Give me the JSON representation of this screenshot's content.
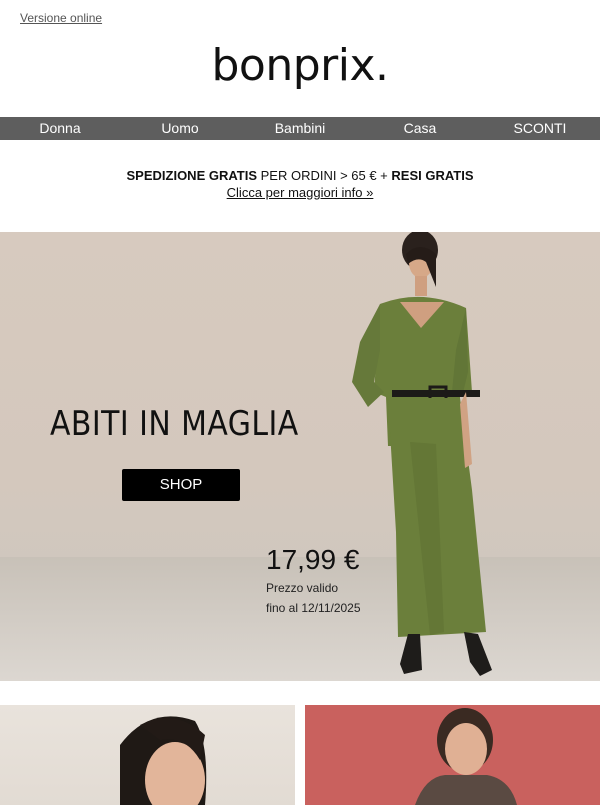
{
  "header": {
    "online_link": "Versione online",
    "logo": "bonprix."
  },
  "nav": {
    "items": [
      "Donna",
      "Uomo",
      "Bambini",
      "Casa",
      "SCONTI"
    ]
  },
  "shipping": {
    "part1_bold": "SPEDIZIONE GRATIS",
    "part2": " PER ORDINI > 65 € + ",
    "part3_bold": "RESI GRATIS",
    "link": "Clicca per maggiori info »"
  },
  "hero": {
    "title": "ABITI IN MAGLIA",
    "button": "SHOP",
    "price": "17,99 €",
    "validity_line1": "Prezzo valido",
    "validity_line2": "fino al 12/11/2025"
  },
  "colors": {
    "nav_bg": "#5e5e5e",
    "dress_green": "#6b7f3b",
    "tile_right_bg": "#c9615e",
    "button_bg": "#000000"
  }
}
